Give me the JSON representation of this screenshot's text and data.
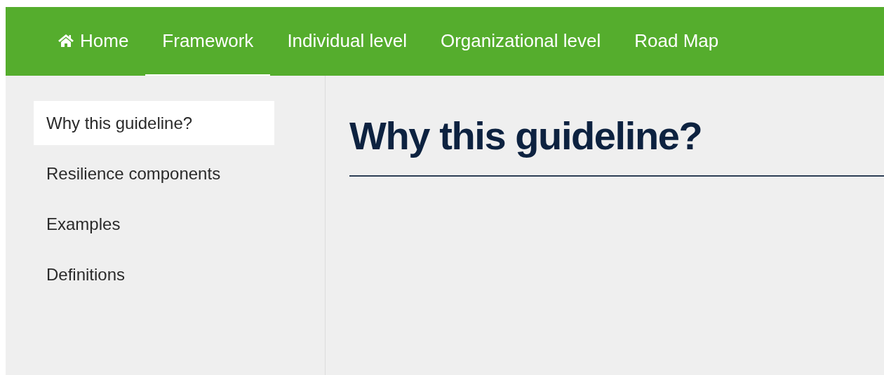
{
  "nav": [
    {
      "kind": "home",
      "label": "Home",
      "selected": false
    },
    {
      "kind": "link",
      "label": "Framework",
      "selected": true
    },
    {
      "kind": "link",
      "label": "Individual level",
      "selected": false
    },
    {
      "kind": "link",
      "label": "Organizational level",
      "selected": false
    },
    {
      "kind": "link",
      "label": "Road Map",
      "selected": false
    }
  ],
  "sidebar": {
    "items": [
      {
        "label": "Why this guideline?",
        "selected": true
      },
      {
        "label": "Resilience components",
        "selected": false
      },
      {
        "label": "Examples",
        "selected": false
      },
      {
        "label": "Definitions",
        "selected": false
      }
    ]
  },
  "heading": "Why this guideline?"
}
